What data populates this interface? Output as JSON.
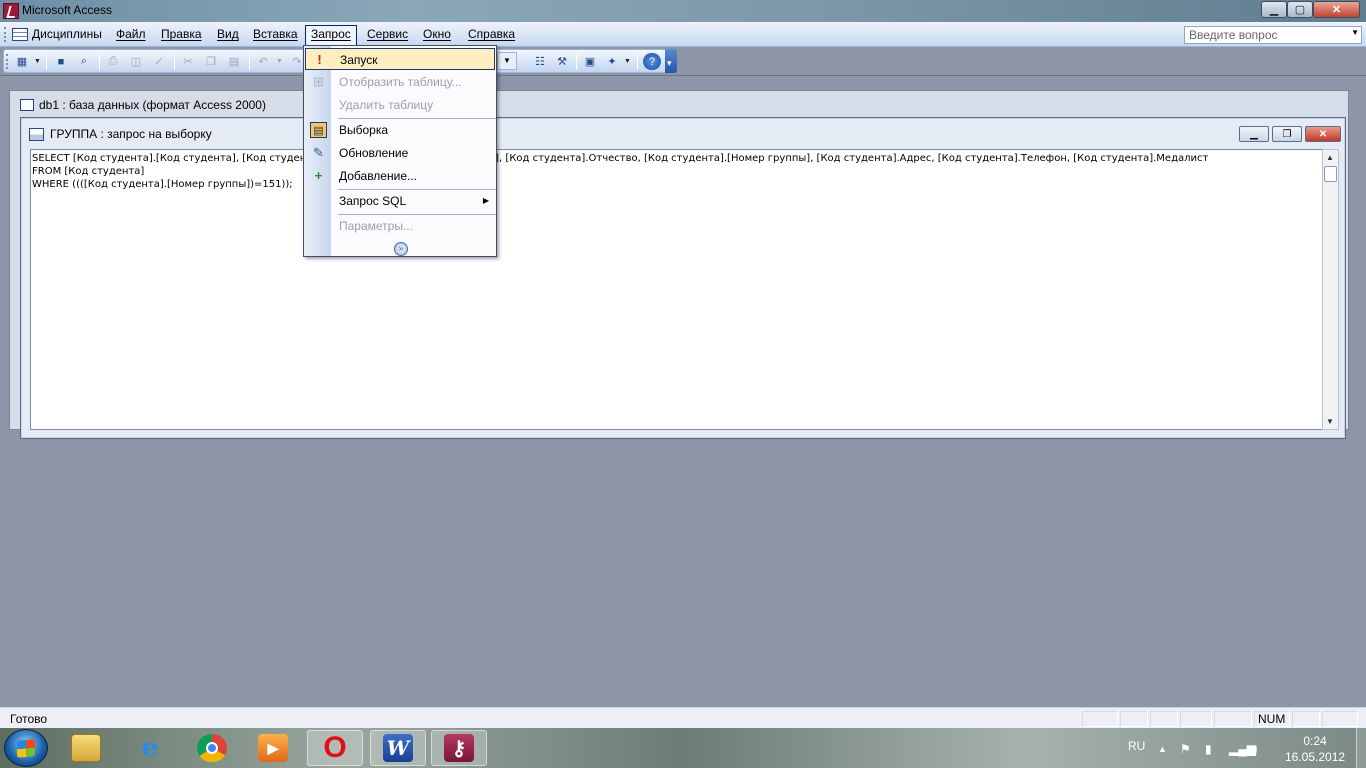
{
  "window": {
    "title": "Microsoft Access"
  },
  "menubar": {
    "items": [
      {
        "label": "Дисциплины"
      },
      {
        "label": "Файл"
      },
      {
        "label": "Правка"
      },
      {
        "label": "Вид"
      },
      {
        "label": "Вставка"
      },
      {
        "label": "Запрос"
      },
      {
        "label": "Сервис"
      },
      {
        "label": "Окно"
      },
      {
        "label": "Справка"
      }
    ],
    "help_placeholder": "Введите вопрос"
  },
  "db_window": {
    "title": "db1 : база данных (формат Access 2000)"
  },
  "query_window": {
    "title": "ГРУППА : запрос на выборку",
    "sql_text": "SELECT [Код студента].[Код студента], [Код студента].[Фамилия], [Код студента].[Имя], [Код студента].Отчество, [Код студента].[Номер группы], [Код студента].Адрес, [Код студента].Телефон, [Код студента].Медалист\nFROM [Код студента]\nWHERE ((([Код студента].[Номер группы])=151));"
  },
  "query_menu": {
    "items": [
      {
        "label": "Запуск",
        "enabled": true,
        "icon": "exclamation-icon"
      },
      {
        "label": "Отобразить таблицу...",
        "enabled": false,
        "icon": "show-table-icon"
      },
      {
        "label": "Удалить таблицу",
        "enabled": false,
        "icon": ""
      },
      {
        "label": "Выборка",
        "enabled": true,
        "icon": "select-query-icon"
      },
      {
        "label": "Обновление",
        "enabled": true,
        "icon": "update-query-icon"
      },
      {
        "label": "Добавление...",
        "enabled": true,
        "icon": "append-query-icon"
      },
      {
        "label": "Запрос SQL",
        "enabled": true,
        "icon": "",
        "submenu": true
      },
      {
        "label": "Параметры...",
        "enabled": false,
        "icon": ""
      }
    ],
    "expand_icon": "double-chevron-down-icon"
  },
  "statusbar": {
    "status": "Готово",
    "num": "NUM"
  },
  "taskbar": {
    "language": "RU",
    "time": "0:24",
    "date": "16.05.2012"
  },
  "colors": {
    "menu_hover": "#ffeebf",
    "mdi_background": "#8d95a8"
  }
}
